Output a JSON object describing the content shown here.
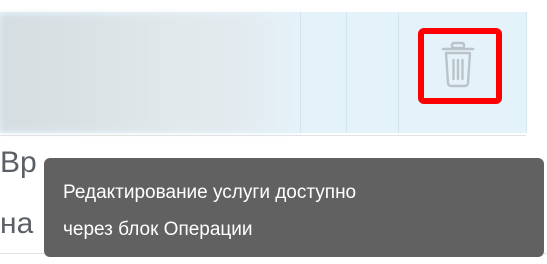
{
  "table_row": {
    "delete_icon": "trash-icon",
    "highlight_color": "#ff0000",
    "row_highlight_color": "#e4f2fa"
  },
  "cell_text": {
    "line1": "Вр",
    "line2": "на"
  },
  "tooltip": {
    "line1": "Редактирование услуги доступно",
    "line2": "через блок Операции",
    "background": "#616161"
  }
}
